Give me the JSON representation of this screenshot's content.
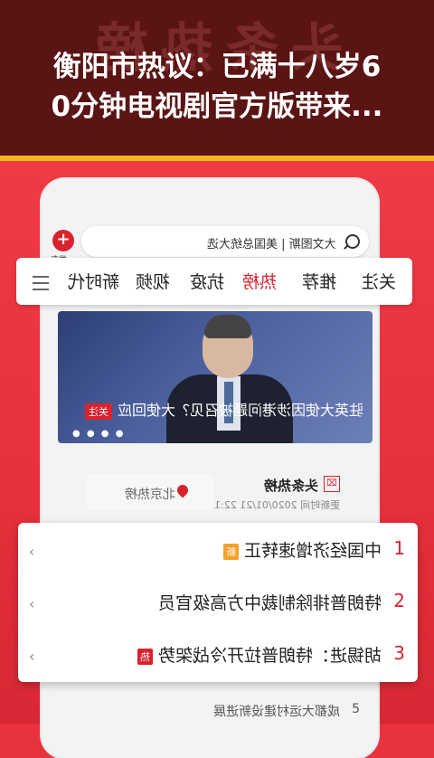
{
  "banner": {
    "watermark": "头条热榜",
    "title_line1": "衡阳市热议：已满十八岁6",
    "title_line2": "0分钟电视剧官方版带来..."
  },
  "app": {
    "add_label": "发布",
    "search_text": "大文图斯 | 美国总统大选",
    "tabs": [
      "关注",
      "推荐",
      "热榜",
      "抗疫",
      "视频",
      "新时代"
    ],
    "active_tab": "热榜",
    "feature": {
      "badge": "关注",
      "caption": "驻英大使因涉港问题被召见？大使回应",
      "dots": "● ● ● ●"
    },
    "list_header": {
      "title": "头条热榜",
      "icon": "hot-list-icon",
      "update_time": "更新时间 2020/01/21 22:12",
      "beijing_label": "北京热榜"
    },
    "hot_items": [
      {
        "rank": "1",
        "text": "中国经济增速转正",
        "tag": "新",
        "tag_type": "new"
      },
      {
        "rank": "2",
        "text": "特朗普排除制裁中方高级官员",
        "tag": "",
        "tag_type": ""
      },
      {
        "rank": "3",
        "text": "胡锡进：特朗普拉开冷战架势",
        "tag": "热",
        "tag_type": "hot"
      }
    ],
    "bottom_item": {
      "rank": "5",
      "text": "成都大运村建设新进展"
    }
  },
  "colors": {
    "accent": "#d8232f",
    "banner_bg": "#5a1414",
    "gold": "#f5b81c",
    "bg": "#e8323d"
  }
}
